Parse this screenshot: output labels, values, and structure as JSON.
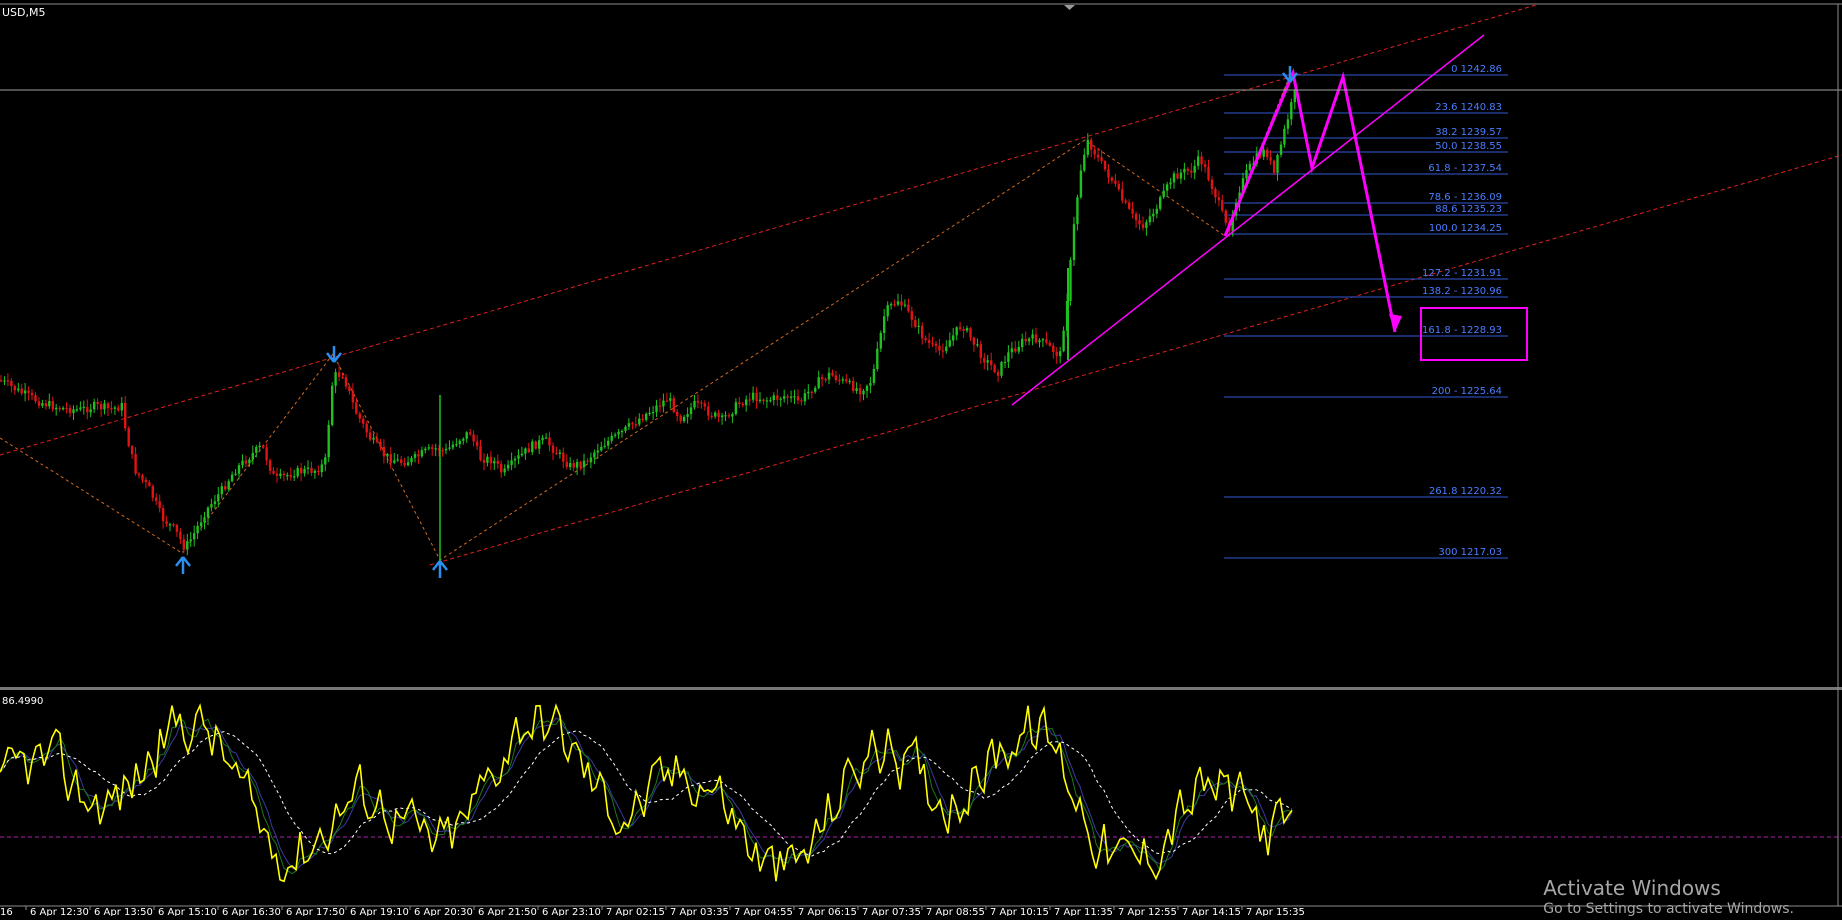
{
  "window": {
    "symbol_label": "USD,M5",
    "indicator_label": "86.4990"
  },
  "colors": {
    "background": "#000000",
    "bull": "#1fc11f",
    "bear": "#e01414",
    "channel": "#e02020",
    "zigzag": "#d2691e",
    "fibo": "#3657d6",
    "fibo_text": "#4a7dff",
    "trend": "#ff00ff",
    "arrow": "#2a8ff0",
    "stoch_main": "#ffff00",
    "stoch_signal_1": "#1a7a1a",
    "stoch_signal_2": "#3a3aa0",
    "stoch_avg": "#ffffff",
    "level_line": "#b020b0",
    "separator": "#8c8c8c"
  },
  "fibo_levels": [
    {
      "label": "0 1242.86"
    },
    {
      "label": "23.6 1240.83"
    },
    {
      "label": "38.2 1239.57"
    },
    {
      "label": "50.0 1238.55"
    },
    {
      "label": "61.8 - 1237.54"
    },
    {
      "label": "78.6 - 1236.09"
    },
    {
      "label": "88.6 1235.23"
    },
    {
      "label": "100.0 1234.25"
    },
    {
      "label": "127.2 - 1231.91"
    },
    {
      "label": "138.2 - 1230.96"
    },
    {
      "label": "161.8 -  1228.93"
    },
    {
      "label": "200 - 1225.64"
    },
    {
      "label": "261.8 1220.32"
    },
    {
      "label": "300 1217.03"
    }
  ],
  "time_axis": [
    "6 Apr 12:30",
    "6 Apr 13:50",
    "6 Apr 15:10",
    "6 Apr 16:30",
    "6 Apr 17:50",
    "6 Apr 19:10",
    "6 Apr 20:30",
    "6 Apr 21:50",
    "6 Apr 23:10",
    "7 Apr 02:15",
    "7 Apr 03:35",
    "7 Apr 04:55",
    "7 Apr 06:15",
    "7 Apr 07:35",
    "7 Apr 08:55",
    "7 Apr 10:15",
    "7 Apr 11:35",
    "7 Apr 12:55",
    "7 Apr 14:15",
    "7 Apr 15:35"
  ],
  "time_axis_partial": "16",
  "watermark": {
    "line1": "Activate Windows",
    "line2": "Go to Settings to activate Windows."
  },
  "icons": {
    "up_arrow": "up-arrow-icon",
    "down_arrow": "down-arrow-icon",
    "scroll_marker": "scroll-marker-icon"
  }
}
